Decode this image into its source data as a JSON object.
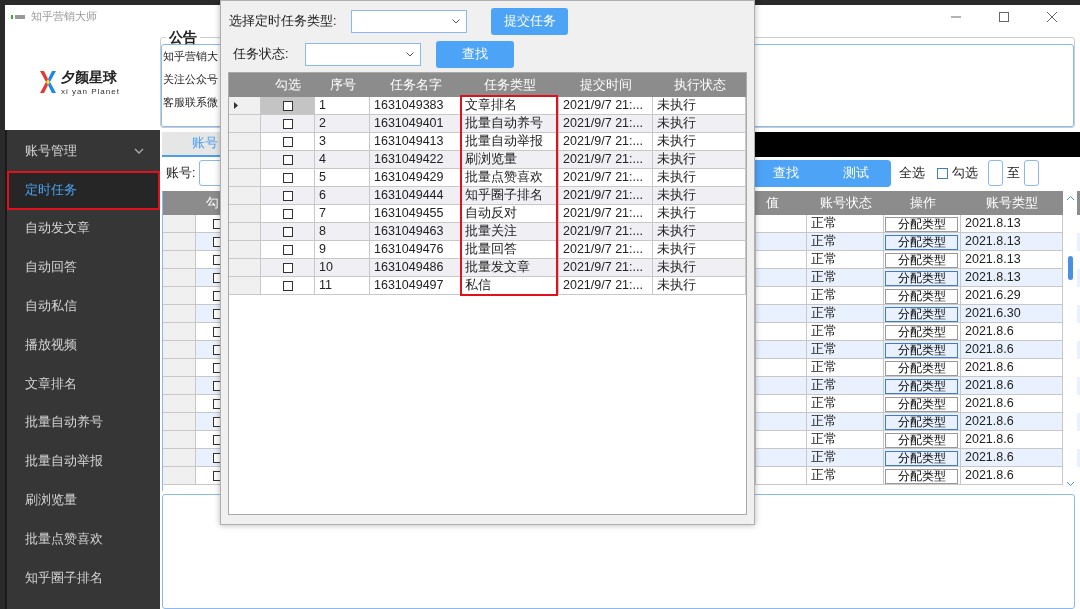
{
  "main_window": {
    "title": "知乎营销大师",
    "logo": {
      "name": "夕颜星球",
      "tagline": "xi yan Planet"
    },
    "notice": {
      "title": "公告",
      "lines": [
        "知乎营销大",
        "关注公众号",
        "客服联系微"
      ]
    }
  },
  "sidebar": {
    "items": [
      {
        "label": "账号管理",
        "kind": "group",
        "expanded": true,
        "selected": false
      },
      {
        "label": "定时任务",
        "kind": "item",
        "selected": true
      },
      {
        "label": "自动发文章",
        "kind": "item",
        "selected": false
      },
      {
        "label": "自动回答",
        "kind": "item",
        "selected": false
      },
      {
        "label": "自动私信",
        "kind": "item",
        "selected": false
      },
      {
        "label": "播放视频",
        "kind": "item",
        "selected": false
      },
      {
        "label": "文章排名",
        "kind": "item",
        "selected": false
      },
      {
        "label": "批量自动养号",
        "kind": "item",
        "selected": false
      },
      {
        "label": "批量自动举报",
        "kind": "item",
        "selected": false
      },
      {
        "label": "刷浏览量",
        "kind": "item",
        "selected": false
      },
      {
        "label": "批量点赞喜欢",
        "kind": "item",
        "selected": false
      },
      {
        "label": "知乎圈子排名",
        "kind": "item",
        "selected": false
      }
    ]
  },
  "tabs": [
    {
      "label": "账号",
      "selected": true
    }
  ],
  "toolbar": {
    "account_label": "账号:",
    "buttons": [
      "查找",
      "测试"
    ],
    "select_all": "全选",
    "check": {
      "label": "勾选",
      "checked": false
    },
    "range_separator": "至"
  },
  "accounts_table": {
    "columns": [
      "勾",
      "值",
      "账号状态",
      "操作",
      "账号类型"
    ],
    "rows": [
      {
        "checked": false,
        "status": "正常",
        "action": "分配类型",
        "type": "2021.8.13"
      },
      {
        "checked": false,
        "status": "正常",
        "action": "分配类型",
        "type": "2021.8.13"
      },
      {
        "checked": false,
        "status": "正常",
        "action": "分配类型",
        "type": "2021.8.13"
      },
      {
        "checked": false,
        "status": "正常",
        "action": "分配类型",
        "type": "2021.8.13"
      },
      {
        "checked": false,
        "status": "正常",
        "action": "分配类型",
        "type": "2021.6.29"
      },
      {
        "checked": false,
        "status": "正常",
        "action": "分配类型",
        "type": "2021.6.30"
      },
      {
        "checked": false,
        "status": "正常",
        "action": "分配类型",
        "type": "2021.8.6"
      },
      {
        "checked": false,
        "status": "正常",
        "action": "分配类型",
        "type": "2021.8.6"
      },
      {
        "checked": false,
        "status": "正常",
        "action": "分配类型",
        "type": "2021.8.6"
      },
      {
        "checked": false,
        "status": "正常",
        "action": "分配类型",
        "type": "2021.8.6"
      },
      {
        "checked": false,
        "status": "正常",
        "action": "分配类型",
        "type": "2021.8.6"
      },
      {
        "checked": false,
        "status": "正常",
        "action": "分配类型",
        "type": "2021.8.6"
      },
      {
        "checked": false,
        "status": "正常",
        "action": "分配类型",
        "type": "2021.8.6"
      },
      {
        "checked": false,
        "status": "正常",
        "action": "分配类型",
        "type": "2021.8.6"
      },
      {
        "checked": false,
        "status": "正常",
        "action": "分配类型",
        "type": "2021.8.6"
      }
    ]
  },
  "dialog": {
    "type_label": "选择定时任务类型:",
    "submit_button": "提交任务",
    "status_label": "任务状态:",
    "search_button": "查找",
    "table": {
      "columns": [
        "勾选",
        "序号",
        "任务名字",
        "任务类型",
        "提交时间",
        "执行状态"
      ],
      "rows": [
        {
          "selected": true,
          "checked": false,
          "seq": "1",
          "name": "1631049383",
          "type": "文章排名",
          "time": "2021/9/7 21:...",
          "status": "未执行"
        },
        {
          "selected": false,
          "checked": false,
          "seq": "2",
          "name": "1631049401",
          "type": "批量自动养号",
          "time": "2021/9/7 21:...",
          "status": "未执行"
        },
        {
          "selected": false,
          "checked": false,
          "seq": "3",
          "name": "1631049413",
          "type": "批量自动举报",
          "time": "2021/9/7 21:...",
          "status": "未执行"
        },
        {
          "selected": false,
          "checked": false,
          "seq": "4",
          "name": "1631049422",
          "type": "刷浏览量",
          "time": "2021/9/7 21:...",
          "status": "未执行"
        },
        {
          "selected": false,
          "checked": false,
          "seq": "5",
          "name": "1631049429",
          "type": "批量点赞喜欢",
          "time": "2021/9/7 21:...",
          "status": "未执行"
        },
        {
          "selected": false,
          "checked": false,
          "seq": "6",
          "name": "1631049444",
          "type": "知乎圈子排名",
          "time": "2021/9/7 21:...",
          "status": "未执行"
        },
        {
          "selected": false,
          "checked": false,
          "seq": "7",
          "name": "1631049455",
          "type": "自动反对",
          "time": "2021/9/7 21:...",
          "status": "未执行"
        },
        {
          "selected": false,
          "checked": false,
          "seq": "8",
          "name": "1631049463",
          "type": "批量关注",
          "time": "2021/9/7 21:...",
          "status": "未执行"
        },
        {
          "selected": false,
          "checked": false,
          "seq": "9",
          "name": "1631049476",
          "type": "批量回答",
          "time": "2021/9/7 21:...",
          "status": "未执行"
        },
        {
          "selected": false,
          "checked": false,
          "seq": "10",
          "name": "1631049486",
          "type": "批量发文章",
          "time": "2021/9/7 21:...",
          "status": "未执行"
        },
        {
          "selected": false,
          "checked": false,
          "seq": "11",
          "name": "1631049497",
          "type": "私信",
          "time": "2021/9/7 21:...",
          "status": "未执行"
        }
      ]
    }
  }
}
